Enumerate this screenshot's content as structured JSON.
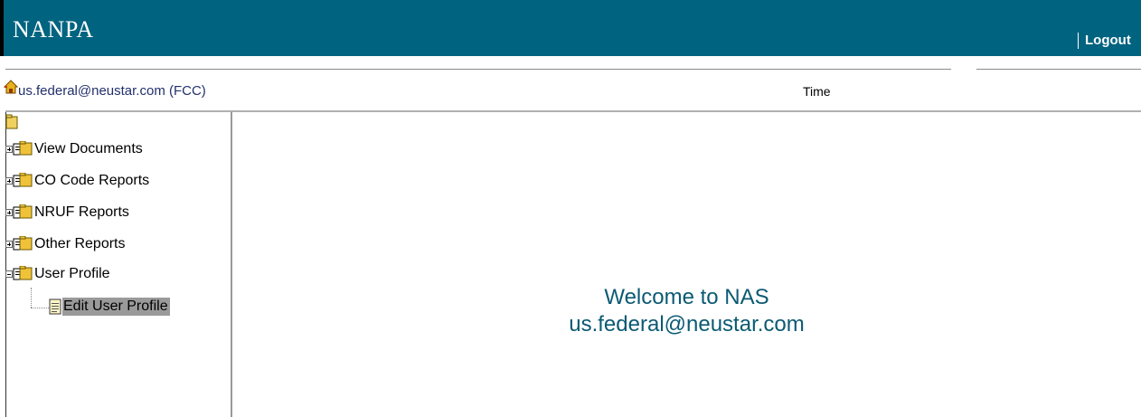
{
  "header": {
    "brand": "NANPA",
    "logout_label": "Logout"
  },
  "userbar": {
    "user": "us.federal@neustar.com (FCC)",
    "time_label": "Time"
  },
  "tree": {
    "items": [
      {
        "label": "View Documents",
        "expanded": false
      },
      {
        "label": "CO Code Reports",
        "expanded": false
      },
      {
        "label": "NRUF Reports",
        "expanded": false
      },
      {
        "label": "Other Reports",
        "expanded": false
      },
      {
        "label": "User Profile",
        "expanded": true
      }
    ],
    "child": {
      "label": "Edit User Profile",
      "selected": true
    }
  },
  "main": {
    "welcome_line1": "Welcome to NAS",
    "welcome_line2": "us.federal@neustar.com"
  },
  "colors": {
    "header_bg": "#00637f",
    "welcome_text": "#0b5a73",
    "selected_bg": "#9a9a9a"
  }
}
